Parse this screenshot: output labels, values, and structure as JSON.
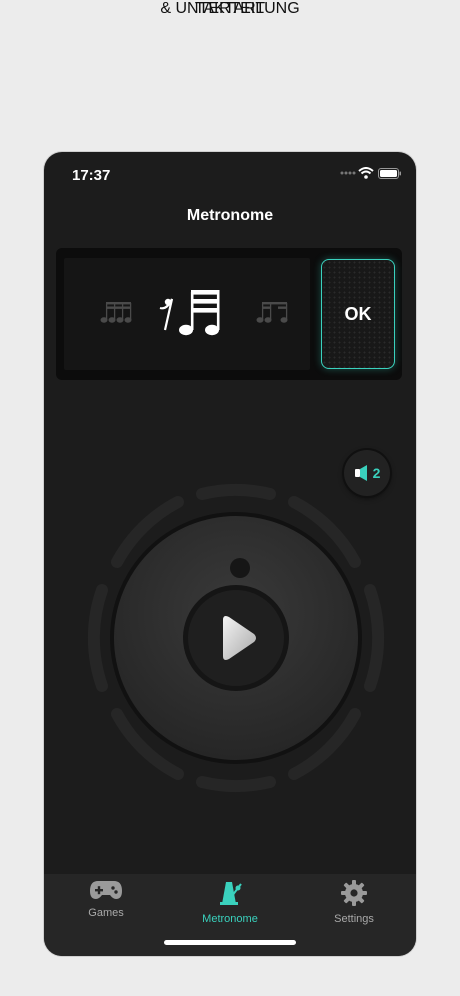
{
  "headline": {
    "line1": "TAKTART",
    "line2": "& UNTERTEILUNG"
  },
  "status_bar": {
    "time": "17:37"
  },
  "nav": {
    "title": "Metronome"
  },
  "subdivision_picker": {
    "confirm_label": "OK"
  },
  "sound": {
    "count": "2"
  },
  "tabs": [
    {
      "label": "Games",
      "icon": "gamepad-icon",
      "active": false
    },
    {
      "label": "Metronome",
      "icon": "metronome-icon",
      "active": true
    },
    {
      "label": "Settings",
      "icon": "gear-icon",
      "active": false
    }
  ],
  "colors": {
    "accent": "#3ad1bd",
    "background": "#1c1c1c",
    "page": "#ececec"
  }
}
